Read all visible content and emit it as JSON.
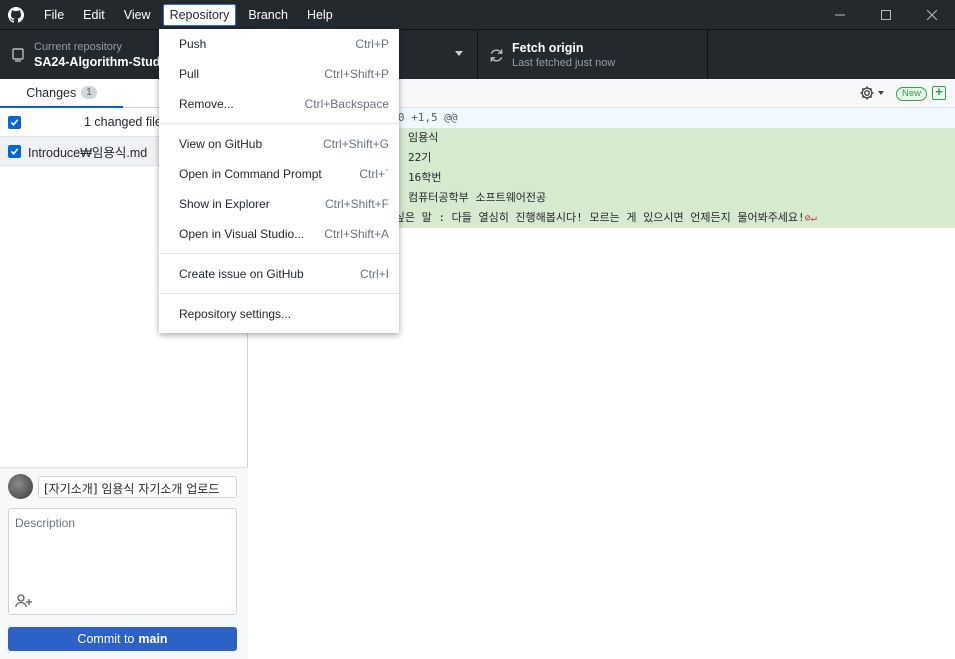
{
  "menubar": {
    "items": [
      "File",
      "Edit",
      "View",
      "Repository",
      "Branch",
      "Help"
    ],
    "active": "Repository"
  },
  "toolbar": {
    "repo_label": "Current repository",
    "repo_name": "SA24-Algorithm-Study",
    "fetch_label": "Fetch origin",
    "fetch_sub": "Last fetched just now"
  },
  "sidebar": {
    "tab_changes": "Changes",
    "changes_badge": "1",
    "changes_count": "1 changed file",
    "file": "Introduce₩임용식.md",
    "summary": "[자기소개] 임용식 자기소개 업로드",
    "description_placeholder": "Description",
    "commit_label": "Commit to",
    "commit_branch": "main"
  },
  "diff": {
    "hunk": "-0,0 +1,5 @@",
    "lines": [
      "름 : 임용식",
      "수 : 22기",
      "번 : 16학번",
      "공 : 컴퓨터공학부 소프트웨어전공",
      "고 싶은 말 : 다들 열심히 진행해봅시다! 모르는 게 있으시면 언제든지 물어봐주세요!"
    ],
    "new_badge": "New"
  },
  "repository_menu": {
    "items": [
      {
        "label": "Push",
        "shortcut": "Ctrl+P"
      },
      {
        "label": "Pull",
        "shortcut": "Ctrl+Shift+P"
      },
      {
        "label": "Remove...",
        "shortcut": "Ctrl+Backspace"
      },
      {
        "label": "View on GitHub",
        "shortcut": "Ctrl+Shift+G"
      },
      {
        "label": "Open in Command Prompt",
        "shortcut": "Ctrl+`"
      },
      {
        "label": "Show in Explorer",
        "shortcut": "Ctrl+Shift+F"
      },
      {
        "label": "Open in Visual Studio...",
        "shortcut": "Ctrl+Shift+A"
      },
      {
        "label": "Create issue on GitHub",
        "shortcut": "Ctrl+I"
      },
      {
        "label": "Repository settings...",
        "shortcut": ""
      }
    ]
  }
}
